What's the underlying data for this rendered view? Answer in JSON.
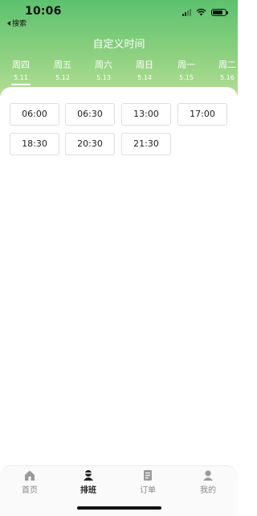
{
  "status_bar": {
    "time": "10:06",
    "back_label": "搜索"
  },
  "header": {
    "title": "自定义时间"
  },
  "days": [
    {
      "weekday": "周四",
      "date": "5.11",
      "selected": true
    },
    {
      "weekday": "周五",
      "date": "5.12",
      "selected": false
    },
    {
      "weekday": "周六",
      "date": "5.13",
      "selected": false
    },
    {
      "weekday": "周日",
      "date": "5.14",
      "selected": false
    },
    {
      "weekday": "周一",
      "date": "5.15",
      "selected": false
    },
    {
      "weekday": "周二",
      "date": "5.16",
      "selected": false
    }
  ],
  "time_slots": [
    "06:00",
    "06:30",
    "13:00",
    "17:00",
    "18:30",
    "20:30",
    "21:30"
  ],
  "tab_bar": {
    "items": [
      {
        "label": "首页",
        "icon": "home-icon",
        "active": false
      },
      {
        "label": "排班",
        "icon": "schedule-icon",
        "active": true
      },
      {
        "label": "订单",
        "icon": "order-icon",
        "active": false
      },
      {
        "label": "我的",
        "icon": "profile-icon",
        "active": false
      }
    ]
  },
  "colors": {
    "header_top": "#5cc26f",
    "header_bottom": "#b5de95",
    "active_tab": "#222222",
    "inactive_tab": "#888888"
  }
}
